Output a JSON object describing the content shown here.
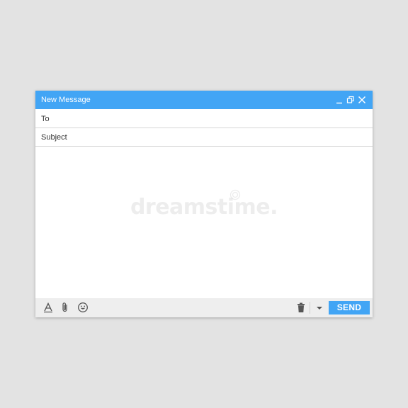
{
  "window": {
    "title": "New Message"
  },
  "titlebar": {
    "icons": [
      "minimize-icon",
      "restore-icon",
      "close-icon"
    ]
  },
  "fields": {
    "to_label": "To",
    "to_value": "",
    "subject_label": "Subject",
    "subject_value": ""
  },
  "body": {
    "content": "",
    "watermark": "dreamstime."
  },
  "toolbar": {
    "left_icons": [
      "text-format-icon",
      "attachment-icon",
      "emoji-icon"
    ],
    "right_icons": [
      "trash-icon",
      "dropdown-arrow-icon"
    ],
    "send_label": "SEND"
  },
  "colors": {
    "accent": "#42a5f5",
    "background": "#e3e3e3",
    "toolbar_bg": "#eeeeee",
    "icon": "#555555"
  }
}
